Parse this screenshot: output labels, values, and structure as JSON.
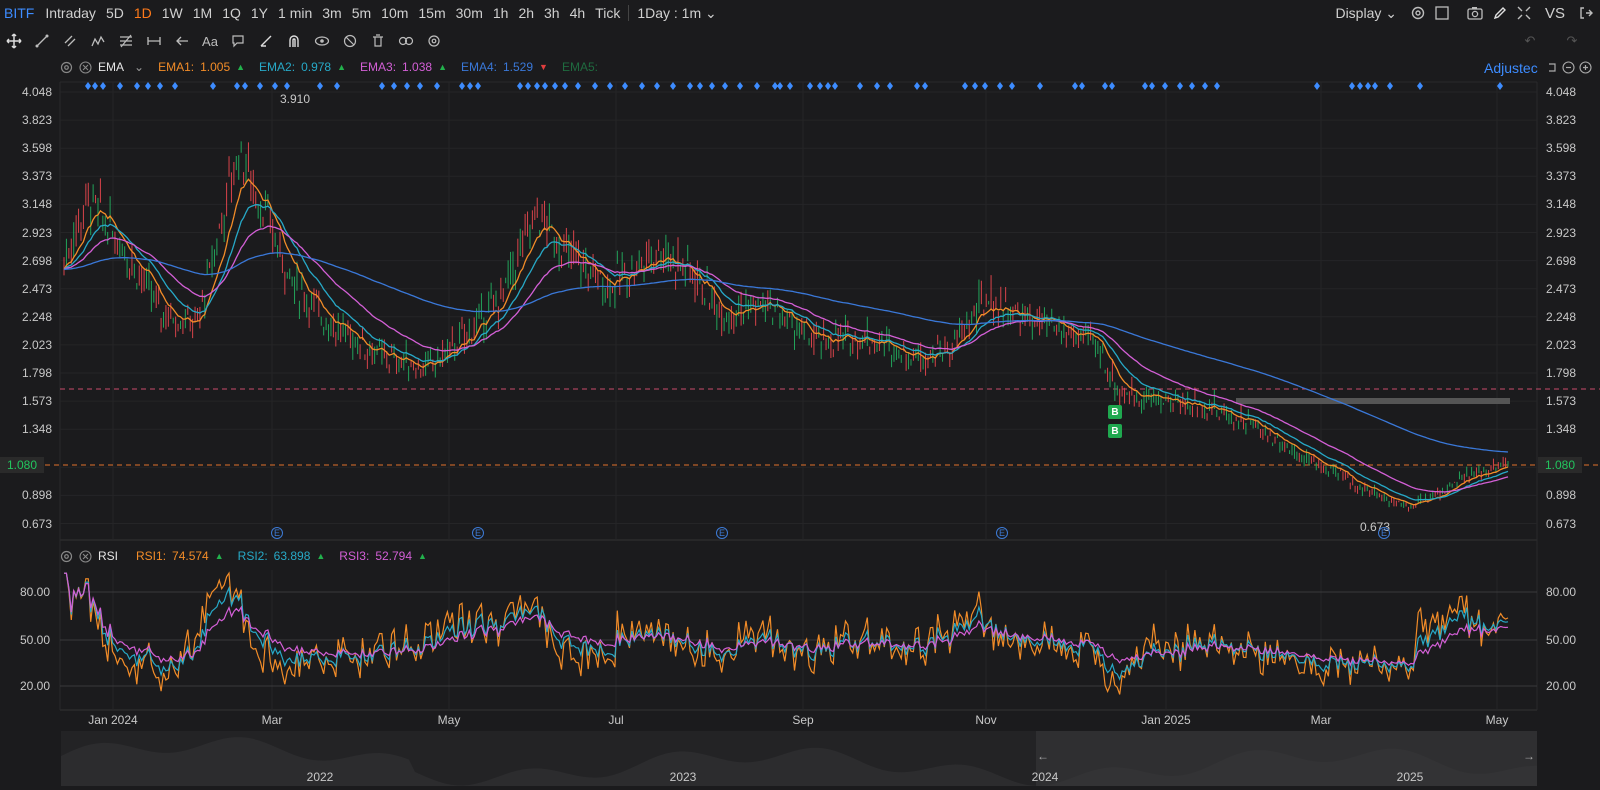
{
  "topbar": {
    "symbol": "BITF",
    "timeframes": [
      "Intraday",
      "5D",
      "1D",
      "1W",
      "1M",
      "1Q",
      "1Y",
      "1 min",
      "3m",
      "5m",
      "10m",
      "15m",
      "30m",
      "1h",
      "2h",
      "3h",
      "4h",
      "Tick"
    ],
    "active": "1D",
    "interval_label": "1Day : 1m",
    "display_label": "Display",
    "vs_label": "VS"
  },
  "toolbar": {
    "tools": [
      "move-icon",
      "line-icon",
      "channel-icon",
      "pattern-icon",
      "fibonacci-icon",
      "measure-icon",
      "arrow-icon",
      "text-icon",
      "comment-icon",
      "brush-icon",
      "magnet-icon",
      "eye-icon",
      "hide-icon",
      "trash-icon",
      "link-icon",
      "settings-icon"
    ]
  },
  "ema_legend": {
    "name": "EMA",
    "items": [
      {
        "label": "EMA1:",
        "value": "1.005",
        "color": "#f28c28",
        "dir": "up"
      },
      {
        "label": "EMA2:",
        "value": "0.978",
        "color": "#27a9c7",
        "dir": "up"
      },
      {
        "label": "EMA3:",
        "value": "1.038",
        "color": "#d35fd6",
        "dir": "up"
      },
      {
        "label": "EMA4:",
        "value": "1.529",
        "color": "#3a78d8",
        "dir": "down"
      },
      {
        "label": "EMA5:",
        "value": "",
        "color": "#1f6b3f",
        "dir": ""
      }
    ]
  },
  "rsi_legend": {
    "name": "RSI",
    "items": [
      {
        "label": "RSI1:",
        "value": "74.574",
        "color": "#f28c28",
        "dir": "up"
      },
      {
        "label": "RSI2:",
        "value": "63.898",
        "color": "#27a9c7",
        "dir": "up"
      },
      {
        "label": "RSI3:",
        "value": "52.794",
        "color": "#d35fd6",
        "dir": "up"
      }
    ]
  },
  "adjusted_label": "Adjustec",
  "price_axis": [
    "4.048",
    "3.823",
    "3.598",
    "3.373",
    "3.148",
    "2.923",
    "2.698",
    "2.473",
    "2.248",
    "2.023",
    "1.798",
    "1.573",
    "1.348",
    "1.080",
    "0.898",
    "0.673"
  ],
  "current_price": "1.080",
  "rsi_axis": [
    "80.00",
    "50.00",
    "20.00"
  ],
  "high_label": "3.910",
  "low_label": "0.673",
  "date_labels": [
    "Jan 2024",
    "Mar",
    "May",
    "Jul",
    "Sep",
    "Nov",
    "Jan 2025",
    "Mar",
    "May"
  ],
  "navigator_labels": [
    "2022",
    "2023",
    "2024",
    "2025"
  ],
  "event_marker": "E",
  "buy_marker": "B",
  "colors": {
    "up": "#22a35a",
    "down": "#d8434a",
    "ema1": "#f28c28",
    "ema2": "#27a9c7",
    "ema3": "#d35fd6",
    "ema4": "#3a78d8",
    "signal": "#3d8cff"
  }
}
